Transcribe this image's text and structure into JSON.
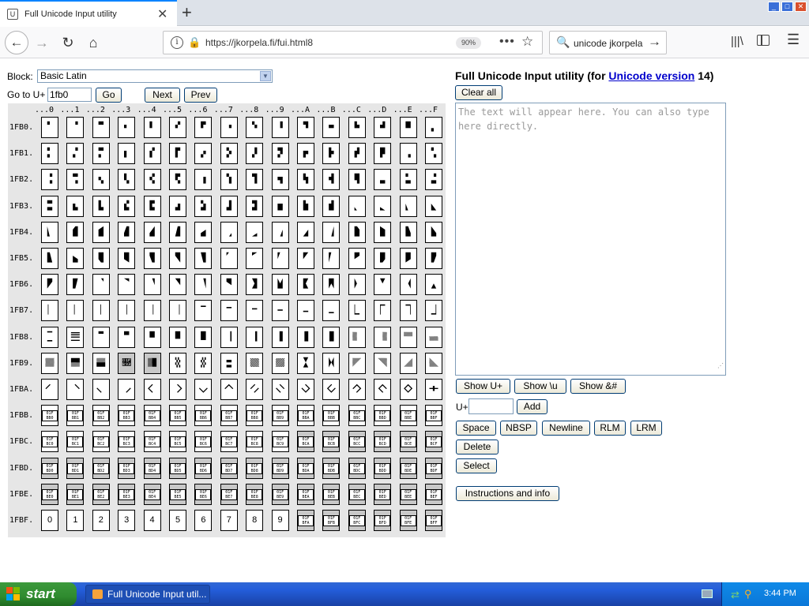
{
  "browser": {
    "tab_title": "Full Unicode Input utility",
    "url": "https://jkorpela.fi/fui.html8",
    "zoom": "90%",
    "search_value": "unicode jkorpela"
  },
  "page": {
    "block_label": "Block:",
    "block_value": "Basic Latin",
    "goto_label": "Go to U+",
    "goto_value": "1fb0",
    "go_label": "Go",
    "next_label": "Next",
    "prev_label": "Prev",
    "title_prefix": "Full Unicode Input utility (for ",
    "title_link": "Unicode version",
    "title_suffix": " 14)",
    "clear_label": "Clear all",
    "textarea_placeholder": "The text will appear here. You can also type here directly.",
    "show_u_label": "Show U+",
    "show_bs_label": "Show \\u",
    "show_amp_label": "Show &#",
    "uplus_label": "U+",
    "add_label": "Add",
    "space_label": "Space",
    "nbsp_label": "NBSP",
    "newline_label": "Newline",
    "rlm_label": "RLM",
    "lrm_label": "LRM",
    "delete_label": "Delete",
    "select_label": "Select",
    "instructions_label": "Instructions and info"
  },
  "grid": {
    "col_headers": [
      "...0",
      "...1",
      "...2",
      "...3",
      "...4",
      "...5",
      "...6",
      "...7",
      "...8",
      "...9",
      "...A",
      "...B",
      "...C",
      "...D",
      "...E",
      "...F"
    ],
    "row_headers": [
      "1FB0.",
      "1FB1.",
      "1FB2.",
      "1FB3.",
      "1FB4.",
      "1FB5.",
      "1FB6.",
      "1FB7.",
      "1FB8.",
      "1FB9.",
      "1FBA.",
      "1FBB.",
      "1FBC.",
      "1FBD.",
      "1FBE.",
      "1FBF."
    ],
    "rows": [
      [
        "🬀",
        "🬁",
        "🬂",
        "🬃",
        "🬄",
        "🬅",
        "🬆",
        "🬇",
        "🬈",
        "🬉",
        "🬊",
        "🬋",
        "🬌",
        "🬍",
        "🬎",
        "🬏"
      ],
      [
        "🬐",
        "🬑",
        "🬒",
        "🬓",
        "🬔",
        "🬕",
        "🬖",
        "🬗",
        "🬘",
        "🬙",
        "🬚",
        "🬛",
        "🬜",
        "🬝",
        "🬞",
        "🬟"
      ],
      [
        "🬠",
        "🬡",
        "🬢",
        "🬣",
        "🬤",
        "🬥",
        "🬦",
        "🬧",
        "🬨",
        "🬩",
        "🬪",
        "🬫",
        "🬬",
        "🬭",
        "🬮",
        "🬯"
      ],
      [
        "🬰",
        "🬱",
        "🬲",
        "🬳",
        "🬴",
        "🬵",
        "🬶",
        "🬷",
        "🬸",
        "🬹",
        "🬺",
        "🬻",
        "🬼",
        "🬽",
        "🬾",
        "🬿"
      ],
      [
        "🭀",
        "🭁",
        "🭂",
        "🭃",
        "🭄",
        "🭅",
        "🭆",
        "🭇",
        "🭈",
        "🭉",
        "🭊",
        "🭋",
        "🭌",
        "🭍",
        "🭎",
        "🭏"
      ],
      [
        "🭐",
        "🭑",
        "🭒",
        "🭓",
        "🭔",
        "🭕",
        "🭖",
        "🭗",
        "🭘",
        "🭙",
        "🭚",
        "🭛",
        "🭜",
        "🭝",
        "🭞",
        "🭟"
      ],
      [
        "🭠",
        "🭡",
        "🭢",
        "🭣",
        "🭤",
        "🭥",
        "🭦",
        "🭧",
        "🭨",
        "🭩",
        "🭪",
        "🭫",
        "🭬",
        "🭭",
        "🭮",
        "🭯"
      ],
      [
        "🭰",
        "🭱",
        "🭲",
        "🭳",
        "🭴",
        "🭵",
        "🭶",
        "🭷",
        "🭸",
        "🭹",
        "🭺",
        "🭻",
        "🭼",
        "🭽",
        "🭾",
        "🭿"
      ],
      [
        "🮀",
        "🮁",
        "🮂",
        "🮃",
        "🮄",
        "🮅",
        "🮆",
        "🮇",
        "🮈",
        "🮉",
        "🮊",
        "🮋",
        "🮌",
        "🮍",
        "🮎",
        "🮏"
      ],
      [
        "🮐",
        "🮑",
        "🮒",
        "🮓",
        "🮔",
        "🮕",
        "🮖",
        "🮗",
        "🮘",
        "🮙",
        "🮚",
        "🮛",
        "🮜",
        "🮝",
        "🮞",
        "🮟"
      ],
      [
        "🮠",
        "🮡",
        "🮢",
        "🮣",
        "🮤",
        "🮥",
        "🮦",
        "🮧",
        "🮨",
        "🮩",
        "🮪",
        "🮫",
        "🮬",
        "🮭",
        "🮮",
        "🮯"
      ],
      [
        "01F BB0",
        "01F BB1",
        "01F BB2",
        "01F BB3",
        "01F BB4",
        "01F BB5",
        "01F BB6",
        "01F BB7",
        "01F BB8",
        "01F BB9",
        "01F BBA",
        "01F BBB",
        "01F BBC",
        "01F BBD",
        "01F BBE",
        "01F BBF"
      ],
      [
        "01F BC0",
        "01F BC1",
        "01F BC2",
        "01F BC3",
        "01F BC4",
        "01F BC5",
        "01F BC6",
        "01F BC7",
        "01F BC8",
        "01F BC9",
        "01F BCA",
        "01F BCB",
        "01F BCC",
        "01F BCD",
        "01F BCE",
        "01F BCF"
      ],
      [
        "01F BD0",
        "01F BD1",
        "01F BD2",
        "01F BD3",
        "01F BD4",
        "01F BD5",
        "01F BD6",
        "01F BD7",
        "01F BD8",
        "01F BD9",
        "01F BDA",
        "01F BDB",
        "01F BDC",
        "01F BDD",
        "01F BDE",
        "01F BDF"
      ],
      [
        "01F BE0",
        "01F BE1",
        "01F BE2",
        "01F BE3",
        "01F BE4",
        "01F BE5",
        "01F BE6",
        "01F BE7",
        "01F BE8",
        "01F BE9",
        "01F BEA",
        "01F BEB",
        "01F BEC",
        "01F BED",
        "01F BEE",
        "01F BEF"
      ],
      [
        "0",
        "1",
        "2",
        "3",
        "4",
        "5",
        "6",
        "7",
        "8",
        "9",
        "01F BFA",
        "01F BFB",
        "01F BFC",
        "01F BFD",
        "01F BFE",
        "01F BFF"
      ]
    ],
    "unassigned_cells": {
      "9": [
        3,
        4
      ],
      "10": [],
      "11": [],
      "12": [
        10,
        11,
        12,
        13,
        14,
        15
      ],
      "13": [
        0,
        1,
        2,
        3,
        4,
        5,
        6,
        7,
        8,
        9,
        10,
        11,
        12,
        13,
        14,
        15
      ],
      "14": [
        0,
        1,
        2,
        3,
        4,
        5,
        6,
        7,
        8,
        9,
        10,
        11,
        12,
        13,
        14,
        15
      ],
      "15": [
        10,
        11,
        12,
        13,
        14,
        15
      ]
    }
  },
  "taskbar": {
    "start_label": "start",
    "task_label": "Full Unicode Input util...",
    "clock": "3:44 PM"
  },
  "colors": {
    "link": "#0000cc",
    "taskbar_blue": "#245edb",
    "start_green": "#2f8b2f"
  }
}
